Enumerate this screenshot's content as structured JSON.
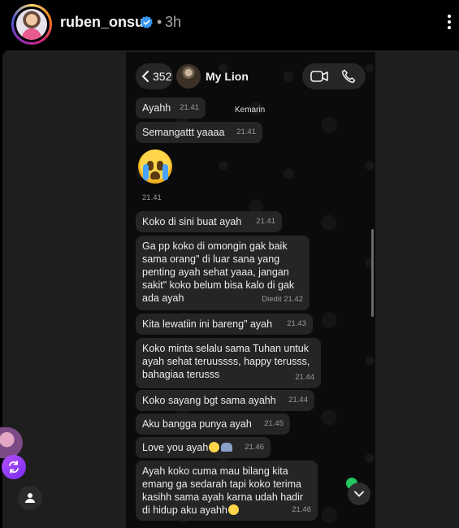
{
  "post": {
    "username": "ruben_onsu",
    "separator": "•",
    "time_ago": "3h"
  },
  "chat": {
    "back_count": "352",
    "contact_name": "My Lion",
    "date_label": "Kemarin",
    "messages": [
      {
        "text": "Ayahh",
        "time": "21.41"
      },
      {
        "text": "Semangattt yaaaa",
        "time": "21.41"
      },
      {
        "text": "😭",
        "time": "21.41"
      },
      {
        "text": "Koko di sini buat ayah",
        "time": "21.41"
      },
      {
        "text": "Ga pp koko di omongin gak baik sama orang\" di luar sana yang penting ayah sehat yaaa, jangan sakit\" koko belum bisa kalo di gak ada ayah",
        "time": "Diedit 21.42"
      },
      {
        "text": "Kita lewatiin ini bareng\" ayah",
        "time": "21.43"
      },
      {
        "text": "Koko minta selalu sama Tuhan untuk ayah sehat teruussss, happy terusss, bahagiaa terusss",
        "time": "21.44"
      },
      {
        "text": "Koko sayang bgt sama ayahh",
        "time": "21.44"
      },
      {
        "text": "Aku bangga punya ayah",
        "time": "21.45"
      },
      {
        "text": "Love you ayah",
        "time": "21.46"
      },
      {
        "text": "Ayah koko cuma mau bilang kita emang ga sedarah tapi koko terima kasihh sama ayah karna udah hadir di hidup aku ayahh",
        "time": "21.46"
      }
    ]
  },
  "icons": {
    "verified": "verified-badge-icon",
    "more": "more-options-icon",
    "back": "chevron-left-icon",
    "video": "video-call-icon",
    "phone": "phone-call-icon",
    "remix": "remix-icon",
    "user": "person-icon",
    "scroll_down": "chevron-down-icon"
  },
  "colors": {
    "verified": "#3897f0",
    "bubble": "#252525",
    "online": "#22c55e",
    "remix": "#8b3dff"
  }
}
